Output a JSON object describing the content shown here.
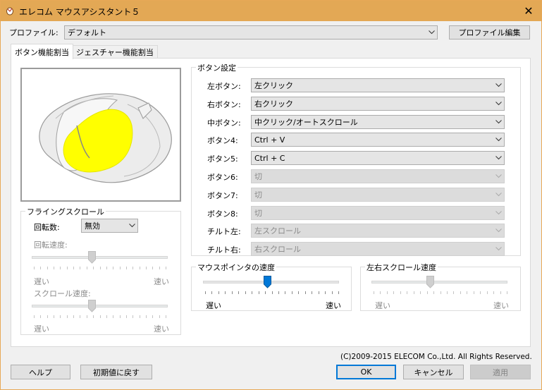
{
  "window": {
    "title": "エレコム マウスアシスタント５",
    "close_glyph": "✕"
  },
  "profile": {
    "label": "プロファイル:",
    "value": "デフォルト",
    "edit_button": "プロファイル編集"
  },
  "tabs": [
    {
      "label": "ボタン機能割当"
    },
    {
      "label": "ジェスチャー機能割当"
    }
  ],
  "button_settings": {
    "title": "ボタン設定",
    "rows": [
      {
        "label": "左ボタン:",
        "value": "左クリック",
        "enabled": true
      },
      {
        "label": "右ボタン:",
        "value": "右クリック",
        "enabled": true
      },
      {
        "label": "中ボタン:",
        "value": "中クリック/オートスクロール",
        "enabled": true
      },
      {
        "label": "ボタン4:",
        "value": "Ctrl + V",
        "enabled": true
      },
      {
        "label": "ボタン5:",
        "value": "Ctrl + C",
        "enabled": true
      },
      {
        "label": "ボタン6:",
        "value": "切",
        "enabled": false
      },
      {
        "label": "ボタン7:",
        "value": "切",
        "enabled": false
      },
      {
        "label": "ボタン8:",
        "value": "切",
        "enabled": false
      },
      {
        "label": "チルト左:",
        "value": "左スクロール",
        "enabled": false
      },
      {
        "label": "チルト右:",
        "value": "右スクロール",
        "enabled": false
      }
    ]
  },
  "flying_scroll": {
    "title": "フライングスクロール",
    "rotation_label": "回転数:",
    "rotation_value": "無効",
    "rotation_speed_label": "回転速度:",
    "scroll_speed_label": "スクロール速度:",
    "slow": "遅い",
    "fast": "速い",
    "rotation_speed_level": 0.5,
    "scroll_speed_level": 0.5
  },
  "pointer_speed": {
    "title": "マウスポインタの速度",
    "slow": "遅い",
    "fast": "速い",
    "level": 0.5
  },
  "hscroll_speed": {
    "title": "左右スクロール速度",
    "slow": "遅い",
    "fast": "速い",
    "level": 0.5
  },
  "copyright": "(C)2009-2015 ELECOM Co.,Ltd. All Rights Reserved.",
  "footer": {
    "help": "ヘルプ",
    "reset": "初期値に戻す",
    "ok": "OK",
    "cancel": "キャンセル",
    "apply": "適用"
  },
  "colors": {
    "titlebar": "#e3a855",
    "highlight": "#ffff00",
    "accent": "#0078d7"
  },
  "icons": {
    "dropdown": "chevron-down-icon"
  }
}
